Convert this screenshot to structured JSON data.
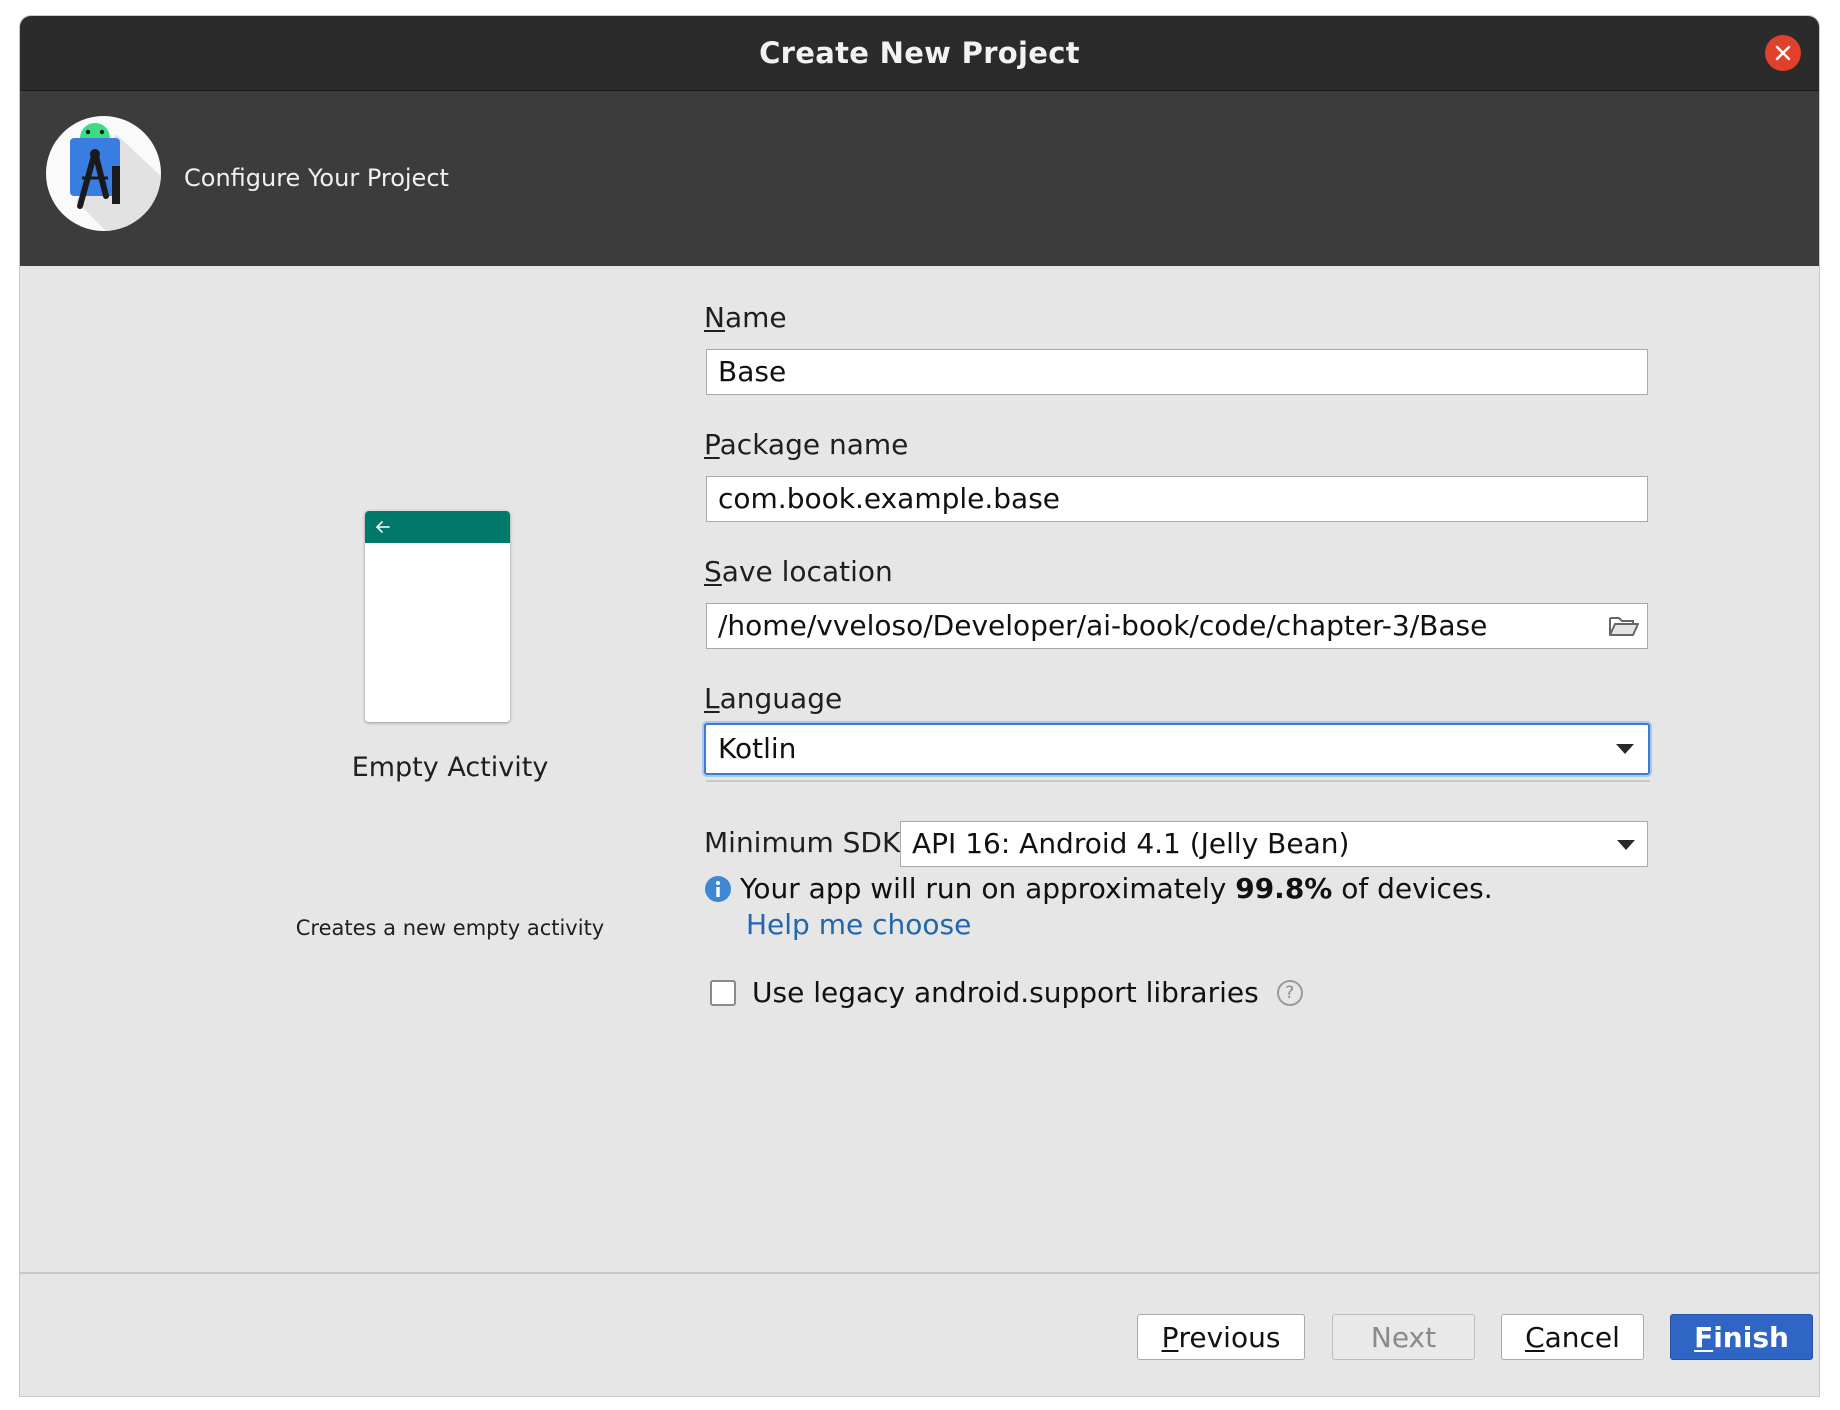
{
  "window": {
    "title": "Create New Project"
  },
  "header": {
    "subtitle": "Configure Your Project",
    "logo_icon": "android-studio-icon"
  },
  "template": {
    "name": "Empty Activity",
    "description": "Creates a new empty activity",
    "appbar_color": "#00796b"
  },
  "form": {
    "name": {
      "mnemonic": "N",
      "label_rest": "ame",
      "value": "Base"
    },
    "package": {
      "mnemonic": "P",
      "label_rest": "ackage name",
      "value": "com.book.example.base"
    },
    "save_location": {
      "mnemonic": "S",
      "label_rest": "ave location",
      "value": "/home/vveloso/Developer/ai-book/code/chapter-3/Base",
      "icon": "folder-icon"
    },
    "language": {
      "mnemonic": "L",
      "label_rest": "anguage",
      "selected": "Kotlin"
    },
    "minimum_sdk": {
      "label": "Minimum SDK",
      "selected": "API 16: Android 4.1 (Jelly Bean)"
    },
    "info": {
      "prefix": "Your app will run on approximately ",
      "percent": "99.8%",
      "suffix": " of devices."
    },
    "help_link": "Help me choose",
    "legacy_checkbox": {
      "label": "Use legacy android.support libraries",
      "checked": false
    }
  },
  "buttons": {
    "previous": {
      "mnemonic": "P",
      "rest": "revious"
    },
    "next": "Next",
    "cancel": {
      "mnemonic": "C",
      "rest": "ancel"
    },
    "finish": {
      "mnemonic": "F",
      "rest": "inish"
    }
  },
  "colors": {
    "accent": "#2f65c5",
    "link": "#2167ae",
    "close": "#e0412b",
    "focus": "#3a7bd5"
  }
}
